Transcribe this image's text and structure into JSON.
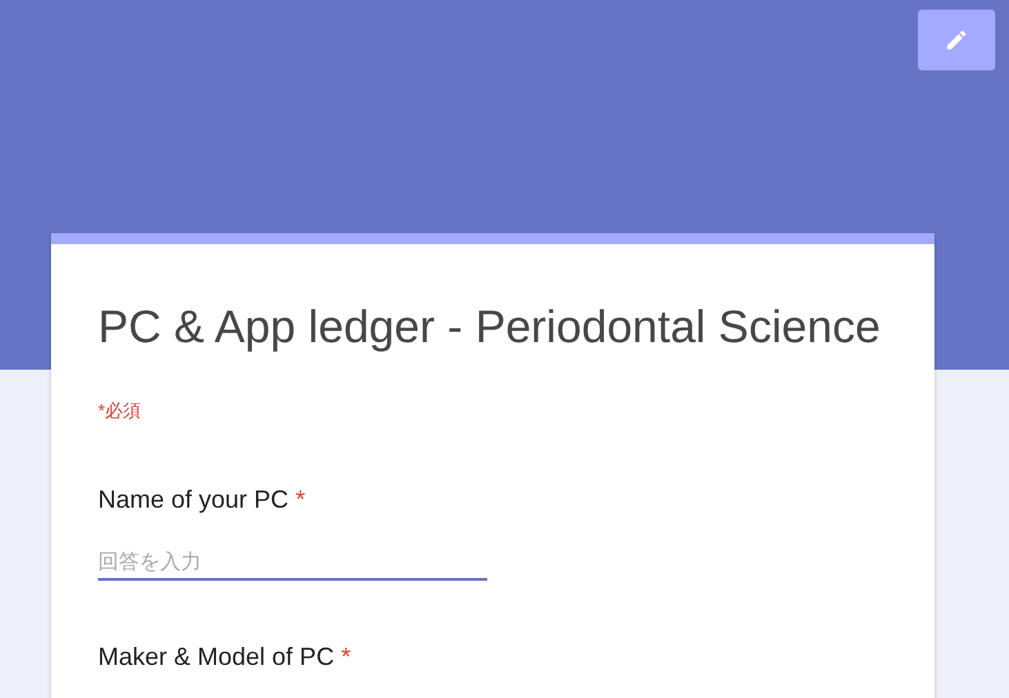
{
  "form": {
    "title": "PC & App ledger - Periodontal Science",
    "required_note": "*必須",
    "questions": [
      {
        "kind": "text",
        "label": "Name of your PC",
        "required": true,
        "required_mark": "*",
        "placeholder": "回答を入力"
      },
      {
        "kind": "heading",
        "label": "Maker & Model of PC",
        "required": true,
        "required_mark": "*"
      }
    ]
  }
}
